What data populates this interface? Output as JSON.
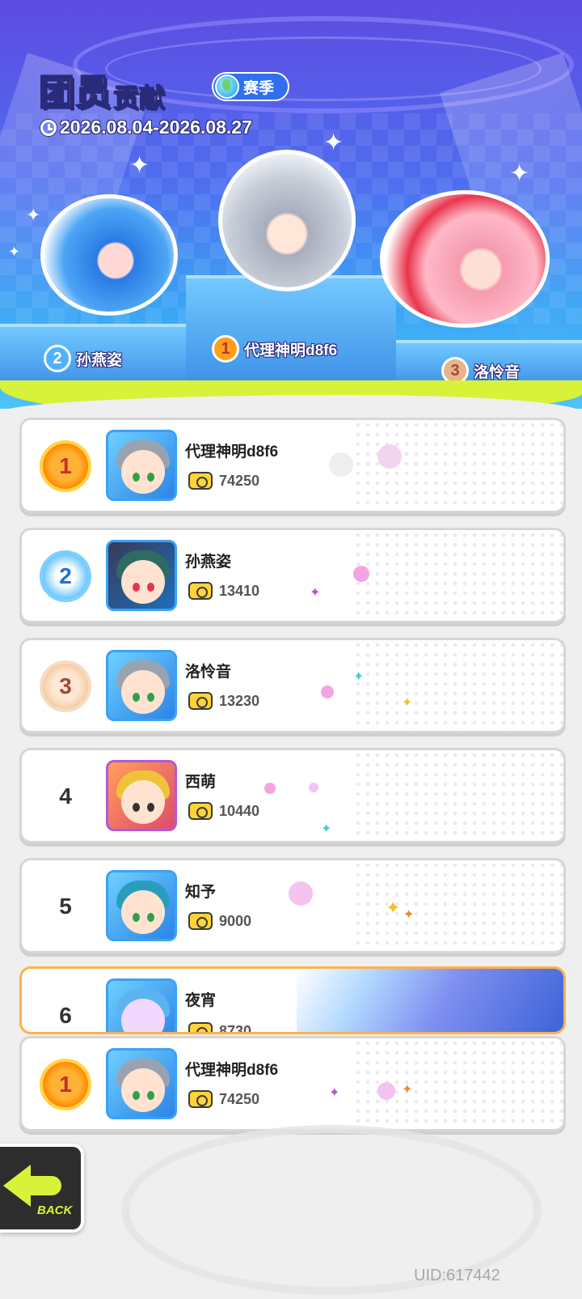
{
  "header": {
    "title_big": "团员",
    "title_small": "贡献",
    "season_label": "赛季",
    "date_range": "2026.08.04-2026.08.27"
  },
  "podium": [
    {
      "rank": "2",
      "name": "孙燕姿",
      "color": "#4fb2ff"
    },
    {
      "rank": "1",
      "name": "代理神明d8f6",
      "color": "#ff9f1a"
    },
    {
      "rank": "3",
      "name": "洛怜音",
      "color": "#e7b48d"
    }
  ],
  "members": [
    {
      "rank": "1",
      "name": "代理神明d8f6",
      "score": "74250",
      "hair": "#9aa2b0"
    },
    {
      "rank": "2",
      "name": "孙燕姿",
      "score": "13410",
      "hair": "#2e6b63"
    },
    {
      "rank": "3",
      "name": "洛怜音",
      "score": "13230",
      "hair": "#9aa2b0"
    },
    {
      "rank": "4",
      "name": "西萌",
      "score": "10440",
      "hair": "#f0c23a"
    },
    {
      "rank": "5",
      "name": "知予",
      "score": "9000",
      "hair": "#2a9dbf"
    },
    {
      "rank": "6",
      "name": "夜宵",
      "score": "8730",
      "hair": "#5db3f0"
    }
  ],
  "self_row": {
    "rank": "1",
    "name": "代理神明d8f6",
    "score": "74250",
    "hair": "#9aa2b0"
  },
  "back_button": {
    "label": "BACK"
  },
  "uid": "UID:617442",
  "colors": {
    "accent_lime": "#d8f23a",
    "header_blue": "#4e6ef0",
    "gold": "#ffb235"
  }
}
